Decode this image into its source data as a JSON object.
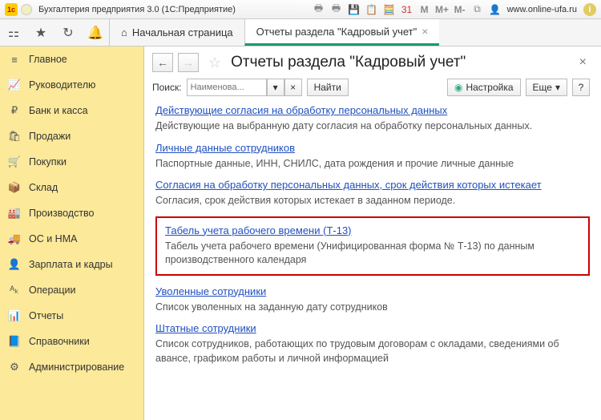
{
  "titlebar": {
    "app_title": "Бухгалтерия предприятия 3.0   (1С:Предприятие)",
    "url_label": "www.online-ufa.ru",
    "m_plus": "M+",
    "m_minus": "M-",
    "m": "M"
  },
  "tabbar": {
    "home_tab": "Начальная страница",
    "active_tab": "Отчеты раздела \"Кадровый учет\""
  },
  "sidebar": {
    "items": [
      {
        "icon": "≡",
        "label": "Главное"
      },
      {
        "icon": "📈",
        "label": "Руководителю"
      },
      {
        "icon": "₽",
        "label": "Банк и касса"
      },
      {
        "icon": "🛍",
        "label": "Продажи"
      },
      {
        "icon": "🛒",
        "label": "Покупки"
      },
      {
        "icon": "📦",
        "label": "Склад"
      },
      {
        "icon": "🏭",
        "label": "Производство"
      },
      {
        "icon": "🚚",
        "label": "ОС и НМА"
      },
      {
        "icon": "👤",
        "label": "Зарплата и кадры"
      },
      {
        "icon": "ᴬₖ",
        "label": "Операции"
      },
      {
        "icon": "📊",
        "label": "Отчеты"
      },
      {
        "icon": "📘",
        "label": "Справочники"
      },
      {
        "icon": "⚙",
        "label": "Администрирование"
      }
    ]
  },
  "content": {
    "page_title": "Отчеты раздела \"Кадровый учет\"",
    "search_label": "Поиск:",
    "search_placeholder": "Наименова...",
    "find_btn": "Найти",
    "settings_btn": "Настройка",
    "more_btn": "Еще",
    "help_btn": "?",
    "reports": [
      {
        "link": "Действующие согласия на обработку персональных данных",
        "desc": "Действующие на выбранную дату согласия на обработку персональных данных."
      },
      {
        "link": "Личные данные сотрудников",
        "desc": "Паспортные данные, ИНН, СНИЛС, дата рождения и прочие личные данные"
      },
      {
        "link": "Согласия на обработку персональных данных, срок действия которых истекает",
        "desc": "Согласия, срок действия которых истекает в заданном периоде."
      },
      {
        "link": "Табель учета рабочего времени (Т-13)",
        "desc": "Табель учета рабочего времени (Унифицированная форма № Т-13) по данным производственного календаря",
        "highlight": true
      },
      {
        "link": "Уволенные сотрудники",
        "desc": "Список уволенных на заданную дату сотрудников"
      },
      {
        "link": "Штатные сотрудники",
        "desc": "Список сотрудников, работающих по трудовым договорам с окладами, сведениями об авансе, графиком работы и личной информацией"
      }
    ]
  }
}
